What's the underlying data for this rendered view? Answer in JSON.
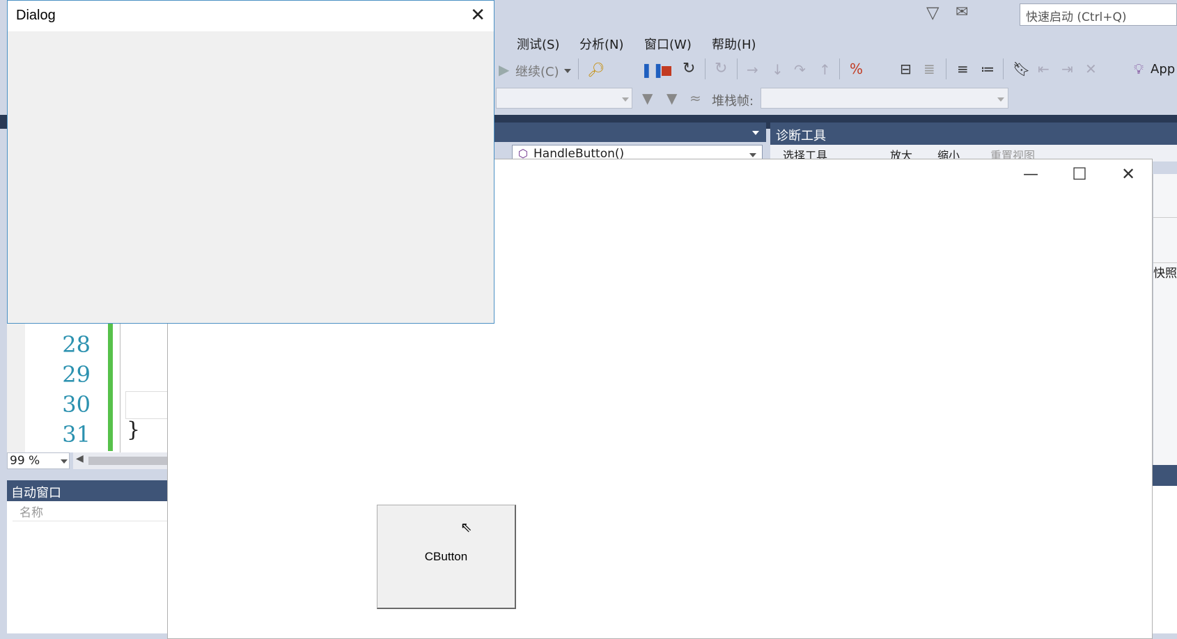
{
  "dialog": {
    "title": "Dialog",
    "close_glyph": "✕"
  },
  "menu": {
    "items": [
      "测试(S)",
      "分析(N)",
      "窗口(W)",
      "帮助(H)"
    ]
  },
  "quick_launch": {
    "placeholder": "快速启动 (Ctrl+Q)"
  },
  "toolbar": {
    "continue_label": "继续(C)",
    "stack_frame_label": "堆栈帧:",
    "app_label": "App"
  },
  "editor": {
    "member_combo": "HandleButton()",
    "line_numbers": [
      "28",
      "29",
      "30",
      "31"
    ],
    "brace": "}",
    "zoom": "99 %"
  },
  "diagnostics": {
    "title": "诊断工具",
    "toolbar_items": [
      "选择工具",
      "放大",
      "缩小",
      "重置视图"
    ],
    "snapshot_label": "快照"
  },
  "auto_window": {
    "title": "自动窗口",
    "column_name": "名称"
  },
  "main_window": {
    "minimize_glyph": "—",
    "maximize_glyph": "☐",
    "close_glyph": "✕",
    "button_label": "CButton"
  },
  "colors": {
    "vs_chrome": "#cfd6e5",
    "vs_dark": "#293955",
    "panel_header": "#3e5477",
    "line_number": "#2b91af",
    "change_bar": "#57c14b",
    "dialog_border": "#4a90c4"
  }
}
